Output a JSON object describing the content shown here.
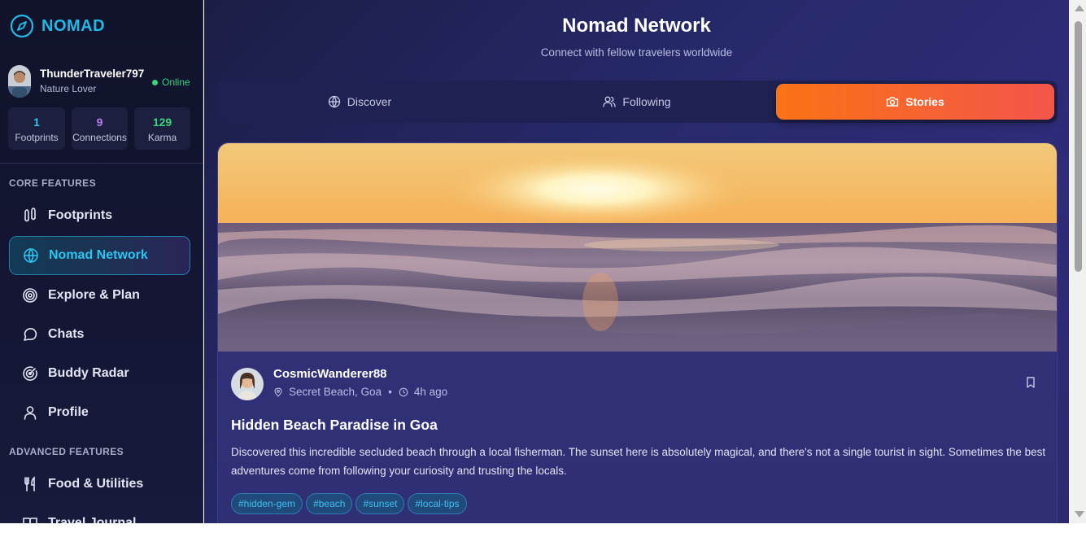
{
  "brand": {
    "name": "NOMAD",
    "color": "#22b8e6"
  },
  "user": {
    "name": "ThunderTraveler797",
    "subtitle": "Nature Lover",
    "status": "Online",
    "stats": [
      {
        "value": "1",
        "label": "Footprints",
        "color": "#2ec4f0"
      },
      {
        "value": "9",
        "label": "Connections",
        "color": "#b57cf5"
      },
      {
        "value": "129",
        "label": "Karma",
        "color": "#37d67a"
      }
    ]
  },
  "sidebar": {
    "core_label": "CORE FEATURES",
    "core_items": [
      {
        "label": "Footprints",
        "icon": "footprints-icon"
      },
      {
        "label": "Nomad Network",
        "icon": "globe-icon",
        "active": true
      },
      {
        "label": "Explore & Plan",
        "icon": "target-icon"
      },
      {
        "label": "Chats",
        "icon": "chat-bubble-icon"
      },
      {
        "label": "Buddy Radar",
        "icon": "radar-icon"
      },
      {
        "label": "Profile",
        "icon": "user-icon"
      }
    ],
    "advanced_label": "ADVANCED FEATURES",
    "advanced_items": [
      {
        "label": "Food & Utilities",
        "icon": "utensils-icon"
      },
      {
        "label": "Travel Journal",
        "icon": "book-icon"
      }
    ]
  },
  "header": {
    "title": "Nomad Network",
    "subtitle": "Connect with fellow travelers worldwide"
  },
  "tabs": [
    {
      "label": "Discover",
      "icon": "globe-icon"
    },
    {
      "label": "Following",
      "icon": "users-icon"
    },
    {
      "label": "Stories",
      "icon": "camera-icon",
      "active": true
    }
  ],
  "post": {
    "author": "CosmicWanderer88",
    "location": "Secret Beach, Goa",
    "time": "4h ago",
    "title": "Hidden Beach Paradise in Goa",
    "body": "Discovered this incredible secluded beach through a local fisherman. The sunset here is absolutely magical, and there's not a single tourist in sight. Sometimes the best adventures come from following your curiosity and trusting the locals.",
    "tags": [
      "#hidden-gem",
      "#beach",
      "#sunset",
      "#local-tips"
    ]
  },
  "colors": {
    "accent_cyan": "#2ec4f0",
    "tab_active_start": "#f97316",
    "tab_active_end": "#f4554a",
    "online": "#37d67a"
  }
}
